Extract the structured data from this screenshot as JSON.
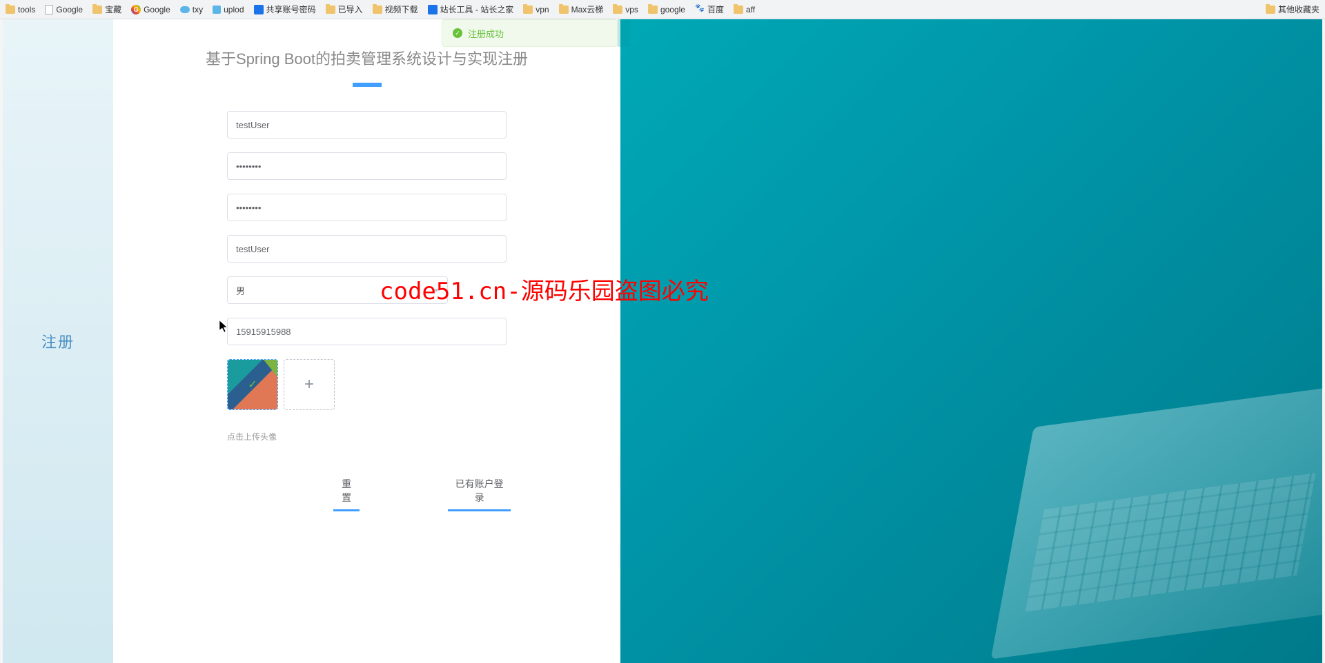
{
  "bookmarks": {
    "left": [
      {
        "label": "tools",
        "icon": "folder"
      },
      {
        "label": "Google",
        "icon": "page"
      },
      {
        "label": "宝藏",
        "icon": "folder"
      },
      {
        "label": "Google",
        "icon": "g"
      },
      {
        "label": "txy",
        "icon": "cloud"
      },
      {
        "label": "uplod",
        "icon": "upload"
      },
      {
        "label": "共享账号密码",
        "icon": "blue"
      },
      {
        "label": "已导入",
        "icon": "folder"
      },
      {
        "label": "视频下载",
        "icon": "folder"
      },
      {
        "label": "站长工具 - 站长之家",
        "icon": "blue"
      },
      {
        "label": "vpn",
        "icon": "folder"
      },
      {
        "label": "Max云梯",
        "icon": "folder"
      },
      {
        "label": "vps",
        "icon": "folder"
      },
      {
        "label": "google",
        "icon": "folder"
      },
      {
        "label": "百度",
        "icon": "paw"
      },
      {
        "label": "aff",
        "icon": "folder"
      }
    ],
    "right": {
      "label": "其他收藏夹",
      "icon": "folder"
    }
  },
  "sidebar": {
    "title": "注册"
  },
  "form": {
    "title": "基于Spring Boot的拍卖管理系统设计与实现注册",
    "username": "testUser",
    "password": "••••••••",
    "confirm_password": "••••••••",
    "nickname": "testUser",
    "gender": "男",
    "phone": "15915915988",
    "upload_hint": "点击上传头像",
    "reset_btn": "重置",
    "login_btn": "已有账户登录"
  },
  "toast": {
    "message": "注册成功"
  },
  "watermark": "code51.cn-源码乐园盗图必究"
}
